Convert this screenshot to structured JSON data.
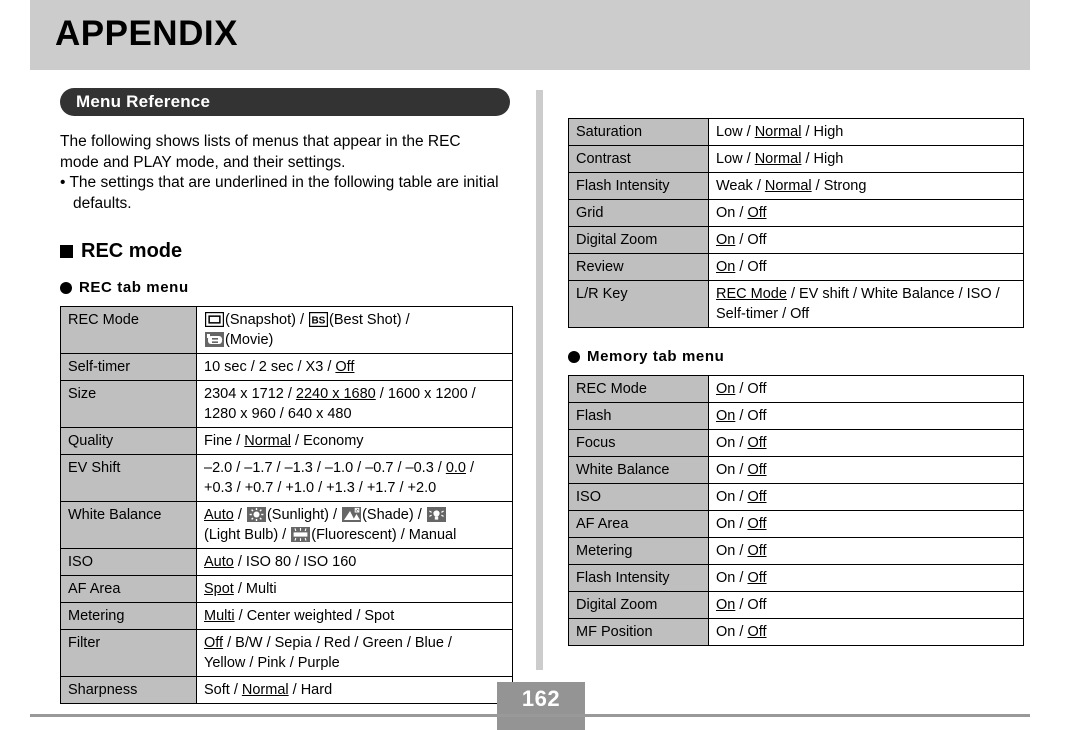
{
  "header": {
    "title": "APPENDIX"
  },
  "section": {
    "banner_label": "Menu Reference",
    "intro_line1": "The following shows lists of menus that appear in the REC",
    "intro_line2": "mode and PLAY mode, and their settings.",
    "intro_bullet": "• The settings that are underlined in the following table are initial defaults."
  },
  "headings": {
    "rec_mode": "REC mode",
    "rec_tab_menu": "REC tab menu",
    "memory_tab_menu": "Memory tab menu"
  },
  "rec_tab_table": {
    "rows": [
      {
        "key": "REC Mode",
        "value_lines": [
          "(Snapshot) / BS (Best Shot) /",
          "(Movie)"
        ],
        "icons": [
          "snapshot-icon",
          "best-shot-icon",
          "movie-icon"
        ]
      },
      {
        "key": "Self-timer",
        "value_lines": [
          "10 sec / 2 sec / X3 / Off"
        ],
        "underlined": [
          "Off"
        ]
      },
      {
        "key": "Size",
        "value_lines": [
          "2304 x 1712 / 2240 x 1680 / 1600 x 1200 /",
          "1280 x 960 / 640 x 480"
        ],
        "underlined": [
          "2240 x 1680"
        ]
      },
      {
        "key": "Quality",
        "value_lines": [
          "Fine / Normal / Economy"
        ],
        "underlined": [
          "Normal"
        ]
      },
      {
        "key": "EV Shift",
        "value_lines": [
          "–2.0 / –1.7 / –1.3 / –1.0 / –0.7 / –0.3 / 0.0 /",
          "+0.3 / +0.7 / +1.0 / +1.3 / +1.7 / +2.0"
        ],
        "underlined": [
          "0.0"
        ]
      },
      {
        "key": "White Balance",
        "value_lines": [
          "Auto / (Sunlight) / (Shade) /",
          "(Light Bulb) / (Fluorescent) / Manual"
        ],
        "underlined": [
          "Auto"
        ],
        "icons": [
          "sunlight-icon",
          "shade-icon",
          "light-bulb-icon",
          "fluorescent-icon"
        ]
      },
      {
        "key": "ISO",
        "value_lines": [
          "Auto  / ISO 80 / ISO 160"
        ],
        "underlined": [
          "Auto"
        ]
      },
      {
        "key": "AF Area",
        "value_lines": [
          "Spot / Multi"
        ],
        "underlined": [
          "Spot"
        ]
      },
      {
        "key": "Metering",
        "value_lines": [
          "Multi / Center weighted / Spot"
        ],
        "underlined": [
          "Multi"
        ]
      },
      {
        "key": "Filter",
        "value_lines": [
          "Off / B/W / Sepia / Red / Green / Blue /",
          "Yellow / Pink / Purple"
        ],
        "underlined": [
          "Off"
        ]
      },
      {
        "key": "Sharpness",
        "value_lines": [
          "Soft / Normal / Hard"
        ],
        "underlined": [
          "Normal"
        ]
      }
    ]
  },
  "rec_tab_table_continued": {
    "rows": [
      {
        "key": "Saturation",
        "value_lines": [
          "Low / Normal / High"
        ],
        "underlined": [
          "Normal"
        ]
      },
      {
        "key": "Contrast",
        "value_lines": [
          "Low / Normal / High"
        ],
        "underlined": [
          "Normal"
        ]
      },
      {
        "key": "Flash Intensity",
        "value_lines": [
          "Weak / Normal / Strong"
        ],
        "underlined": [
          "Normal"
        ]
      },
      {
        "key": "Grid",
        "value_lines": [
          "On / Off"
        ],
        "underlined": [
          "Off"
        ]
      },
      {
        "key": "Digital Zoom",
        "value_lines": [
          "On / Off"
        ],
        "underlined": [
          "On"
        ]
      },
      {
        "key": "Review",
        "value_lines": [
          "On / Off"
        ],
        "underlined": [
          "On"
        ]
      },
      {
        "key": "L/R Key",
        "value_lines": [
          "REC Mode / EV shift / White Balance / ISO /",
          "Self-timer / Off"
        ],
        "underlined": [
          "REC Mode"
        ]
      }
    ]
  },
  "memory_tab_table": {
    "rows": [
      {
        "key": "REC Mode",
        "value_lines": [
          "On / Off"
        ],
        "underlined": [
          "On"
        ]
      },
      {
        "key": "Flash",
        "value_lines": [
          "On / Off"
        ],
        "underlined": [
          "On"
        ]
      },
      {
        "key": "Focus",
        "value_lines": [
          "On / Off"
        ],
        "underlined": [
          "Off"
        ]
      },
      {
        "key": "White Balance",
        "value_lines": [
          "On / Off"
        ],
        "underlined": [
          "Off"
        ]
      },
      {
        "key": "ISO",
        "value_lines": [
          "On / Off"
        ],
        "underlined": [
          "Off"
        ]
      },
      {
        "key": "AF Area",
        "value_lines": [
          "On / Off"
        ],
        "underlined": [
          "Off"
        ]
      },
      {
        "key": "Metering",
        "value_lines": [
          "On / Off"
        ],
        "underlined": [
          "Off"
        ]
      },
      {
        "key": "Flash Intensity",
        "value_lines": [
          "On / Off"
        ],
        "underlined": [
          "Off"
        ]
      },
      {
        "key": "Digital Zoom",
        "value_lines": [
          "On / Off"
        ],
        "underlined": [
          "On"
        ]
      },
      {
        "key": "MF Position",
        "value_lines": [
          "On / Off"
        ],
        "underlined": [
          "Off"
        ]
      }
    ]
  },
  "cells": {
    "rec_mode_snapshot": "(Snapshot) /",
    "rec_mode_bestshot": "(Best Shot) /",
    "rec_mode_movie": "(Movie)",
    "selftimer_pre": "10 sec / 2 sec / X3 / ",
    "selftimer_def": "Off",
    "size_l1_a": "2304 x 1712 / ",
    "size_l1_def": "2240 x 1680",
    "size_l1_b": " / 1600 x 1200 /",
    "size_l2": "1280 x 960 / 640 x 480",
    "quality_a": "Fine / ",
    "quality_def": "Normal",
    "quality_b": " / Economy",
    "ev_l1_a": "–2.0 / –1.7 / –1.3 / –1.0 / –0.7 / –0.3 / ",
    "ev_l1_def": "0.0",
    "ev_l1_b": " /",
    "ev_l2": "+0.3 / +0.7 / +1.0 / +1.3 / +1.7 / +2.0",
    "wb_def": "Auto",
    "wb_sep1": " / ",
    "wb_sunlight": "(Sunlight) /",
    "wb_shade": "(Shade) /",
    "wb_lightbulb": "(Light Bulb) /",
    "wb_fluorescent": "(Fluorescent) / Manual",
    "iso_def": "Auto",
    "iso_rest": "  / ISO 80 / ISO 160",
    "af_def": "Spot",
    "af_rest": " / Multi",
    "met_def": "Multi",
    "met_rest": " / Center weighted / Spot",
    "filter_def": "Off",
    "filter_l1": " / B/W / Sepia / Red / Green / Blue /",
    "filter_l2": "Yellow / Pink / Purple",
    "sharp_a": "Soft / ",
    "sharp_def": "Normal",
    "sharp_b": " / Hard",
    "sat_a": "Low / ",
    "sat_def": "Normal",
    "sat_b": " / High",
    "con_a": "Low / ",
    "con_def": "Normal",
    "con_b": " / High",
    "fi_a": "Weak / ",
    "fi_def": "Normal",
    "fi_b": " / Strong",
    "grid_a": "On / ",
    "grid_def": "Off",
    "dz_def": "On",
    "dz_b": " / Off",
    "rev_def": "On",
    "rev_b": " / Off",
    "lr_def": "REC Mode",
    "lr_l1": " / EV shift / White Balance / ISO /",
    "lr_l2": "Self-timer / Off",
    "on_def": "On",
    "on_rest": " / Off",
    "off_pre": "On / ",
    "off_def": "Off"
  },
  "footer": {
    "page_number": "162"
  },
  "colors": {
    "header_bar": "#cccccc",
    "banner": "#333333",
    "table_key_fill": "#bfbfbf",
    "divider": "#cccccc",
    "page_box": "#949494",
    "footer_rule": "#999999"
  }
}
